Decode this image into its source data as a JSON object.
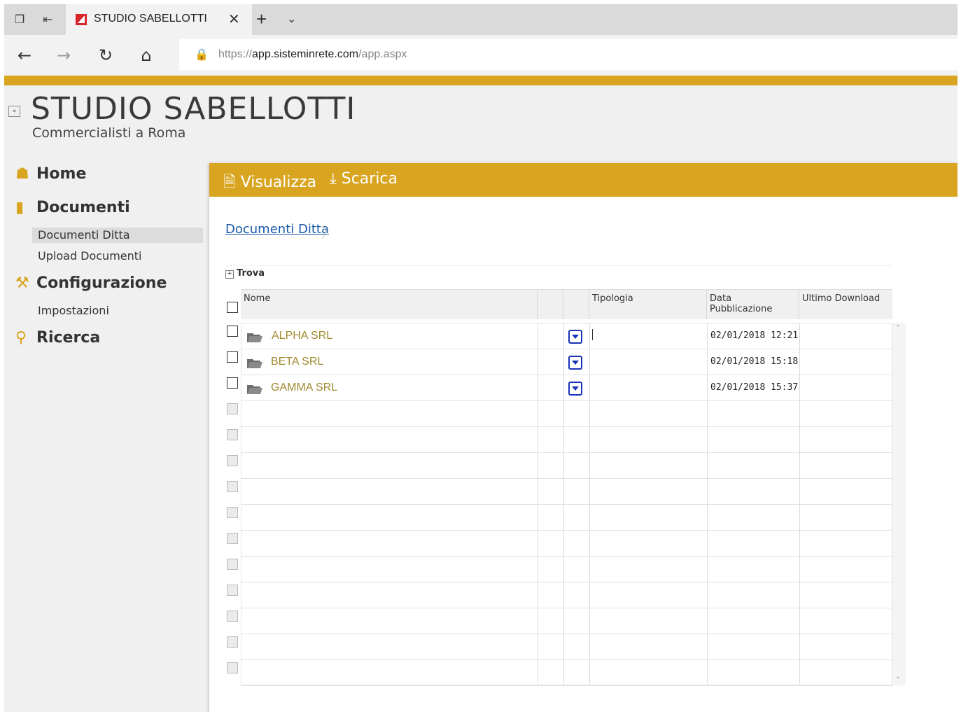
{
  "browser": {
    "tab_title": "STUDIO SABELLOTTI",
    "url_scheme": "https://",
    "url_host": "app.sisteminrete.com",
    "url_path": "/app.aspx"
  },
  "header": {
    "brand": "STUDIO SABELLOTTI",
    "tagline": "Commercialisti a Roma"
  },
  "sidebar": {
    "home": "Home",
    "documenti": "Documenti",
    "documenti_ditta": "Documenti Ditta",
    "upload_documenti": "Upload Documenti",
    "configurazione": "Configurazione",
    "impostazioni": "Impostazioni",
    "ricerca": "Ricerca"
  },
  "toolbar": {
    "visualizza": "Visualizza",
    "scarica": "Scarica"
  },
  "breadcrumb": "Documenti Ditta",
  "find_label": "Trova",
  "columns": {
    "nome": "Nome",
    "tipologia": "Tipologia",
    "data_pubblicazione": "Data Pubblicazione",
    "ultimo_download": "Ultimo Download"
  },
  "rows": [
    {
      "nome": "ALPHA SRL",
      "tipologia": "",
      "data": "02/01/2018 12:21",
      "ultimo": ""
    },
    {
      "nome": "BETA SRL",
      "tipologia": "",
      "data": "02/01/2018 15:18",
      "ultimo": ""
    },
    {
      "nome": "GAMMA SRL",
      "tipologia": "",
      "data": "02/01/2018 15:37",
      "ultimo": ""
    }
  ],
  "colors": {
    "accent": "#d9a521",
    "link": "#1a5aa8",
    "folder_name": "#a08a2e",
    "download_icon": "#1833b8"
  }
}
